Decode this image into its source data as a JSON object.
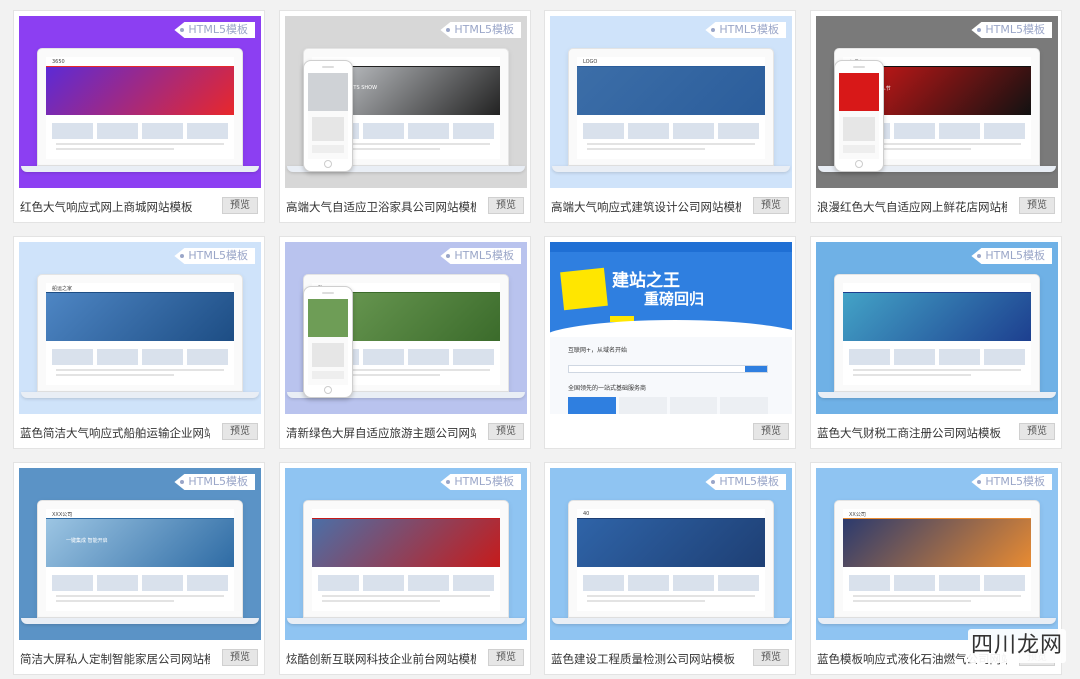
{
  "badge_label": "HTML5模板",
  "preview_label": "预览",
  "cards": [
    {
      "title": "红色大气响应式网上商城网站模板",
      "bg": "#8c3ff2",
      "hero": "#5c2ad6",
      "accent": "#e8282b",
      "inner_text": "3650",
      "kind": "laptop"
    },
    {
      "title": "高端大气自适应卫浴家具公司网站模板",
      "bg": "#d7d7d7",
      "hero": "#cfd2d6",
      "accent": "#222222",
      "inner_text": "XXX公司",
      "inner_sub": "PRODUCTS SHOW",
      "kind": "phone"
    },
    {
      "title": "高端大气响应式建筑设计公司网站模板",
      "bg": "#cfe3fa",
      "hero": "#3c6ea8",
      "accent": "#2b5d9b",
      "inner_text": "LOGO",
      "kind": "laptop"
    },
    {
      "title": "浪漫红色大气自适应网上鲜花店网站模",
      "bg": "#7a7a7a",
      "hero": "#d81818",
      "accent": "#111111",
      "inner_text": "七月七",
      "inner_sub": "2.74 情人节",
      "kind": "phone"
    },
    {
      "title": "蓝色简洁大气响应式船舶运输企业网站",
      "bg": "#cfe3fa",
      "hero": "#4e86c4",
      "accent": "#1d4d84",
      "inner_text": "船运之家",
      "kind": "laptop"
    },
    {
      "title": "清新绿色大屏自适应旅游主题公司网站",
      "bg": "#b9c3ee",
      "hero": "#6e9d56",
      "accent": "#3b6b2b",
      "inner_text": "雅",
      "kind": "phone"
    },
    {
      "title": "",
      "bg": "#eef2f8",
      "hero": "#2f7fe0",
      "accent": "#ffe600",
      "inner_text": "建站之王",
      "inner_sub": "重磅回归",
      "kind": "site"
    },
    {
      "title": "蓝色大气财税工商注册公司网站模板",
      "bg": "#6fb1e6",
      "hero": "#43a3c7",
      "accent": "#1d3f8f",
      "inner_text": "",
      "kind": "laptop"
    },
    {
      "title": "简洁大屏私人定制智能家居公司网站模",
      "bg": "#5b93c6",
      "hero": "#9cc5e3",
      "accent": "#2e6ba4",
      "inner_text": "XXX公司",
      "inner_sub": "一键集成 智能开启",
      "kind": "laptop"
    },
    {
      "title": "炫酷创新互联网科技企业前台网站模板",
      "bg": "#8fc4f2",
      "hero": "#4b6fa7",
      "accent": "#c61b1b",
      "inner_text": "",
      "kind": "laptop"
    },
    {
      "title": "蓝色建设工程质量检测公司网站模板",
      "bg": "#8fc4f2",
      "hero": "#2f64a8",
      "accent": "#1e3f74",
      "inner_text": "40",
      "kind": "laptop"
    },
    {
      "title": "蓝色模板响应式液化石油燃气公司网站",
      "bg": "#8fc4f2",
      "hero": "#2b3a6e",
      "accent": "#e88b32",
      "inner_text": "XX公司",
      "kind": "laptop"
    }
  ],
  "site_card": {
    "search_label": "互联网+，从域名开始",
    "section_title": "全国领先的一站式基础服务商"
  },
  "watermark": "四川龙网"
}
